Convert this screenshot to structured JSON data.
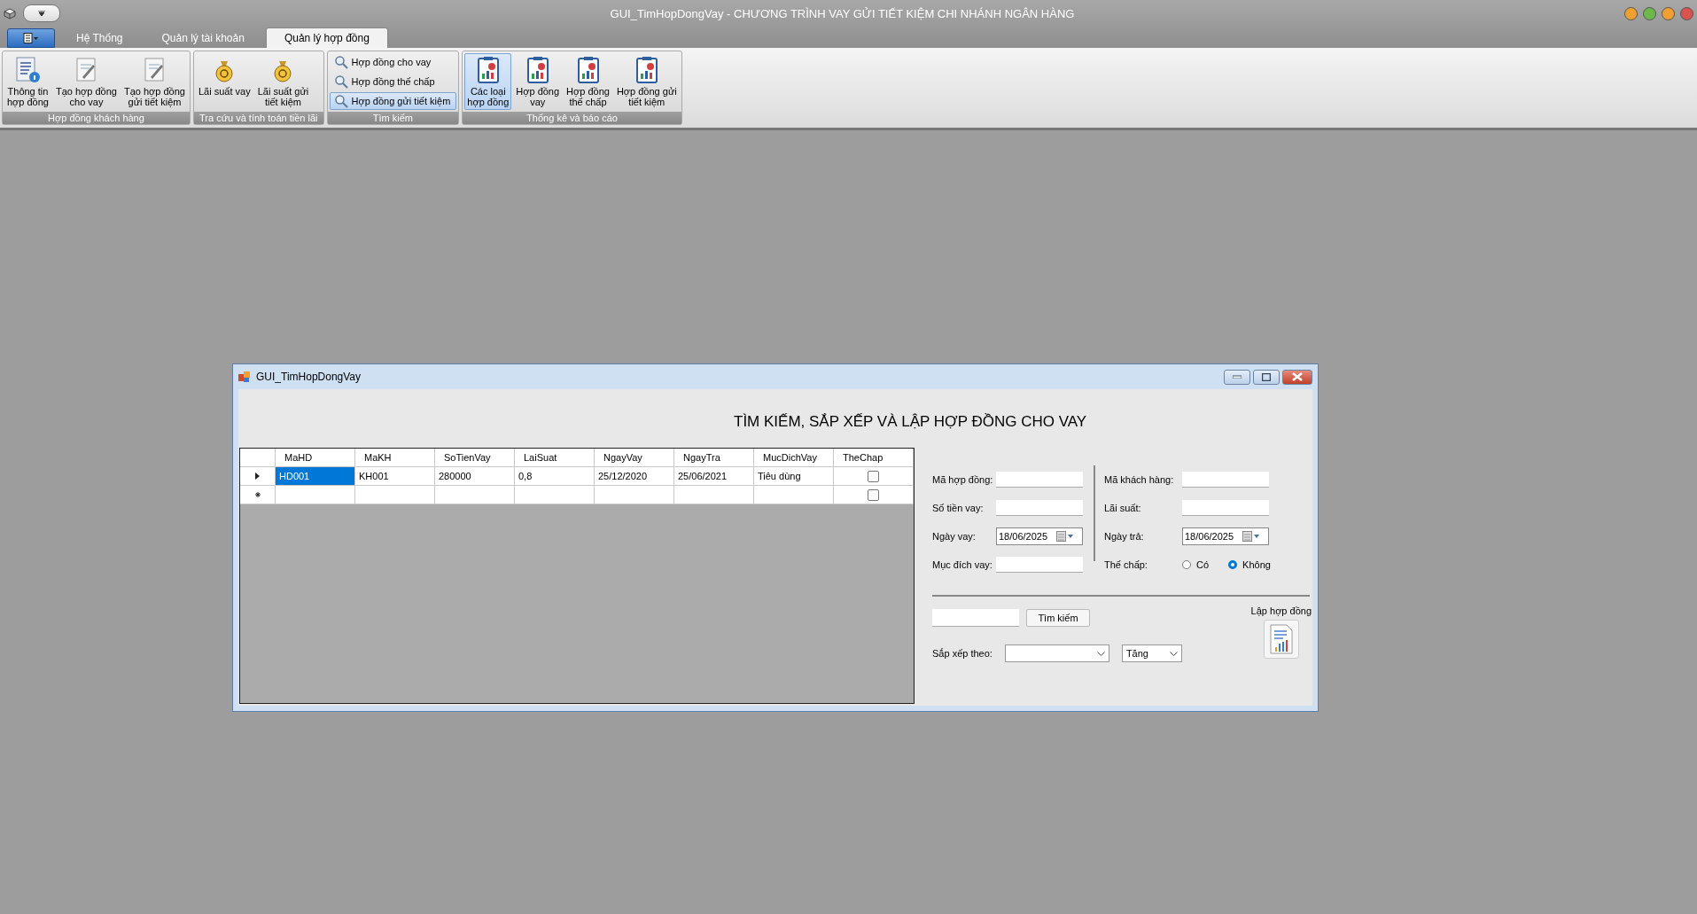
{
  "window": {
    "title": "GUI_TimHopDongVay - CHƯƠNG TRÌNH VAY GỬI TIẾT KIỆM CHI NHÁNH NGÂN HÀNG",
    "orbs": [
      {
        "color": "#f0a030"
      },
      {
        "color": "#6cb84a"
      },
      {
        "color": "#f0a030"
      },
      {
        "color": "#d9534f"
      }
    ]
  },
  "tabs": [
    {
      "label": "Hệ Thống",
      "selected": false
    },
    {
      "label": "Quản lý tài khoản",
      "selected": false
    },
    {
      "label": "Quản lý hợp đồng",
      "selected": true
    }
  ],
  "ribbon_groups": [
    {
      "label": "Hợp đồng khách hàng",
      "items": [
        {
          "kind": "large",
          "label": "Thông tin\nhợp đồng",
          "selected": false
        },
        {
          "kind": "large",
          "label": "Tạo hợp đồng\ncho vay",
          "selected": false
        },
        {
          "kind": "large",
          "label": "Tạo hợp đồng\ngửi tiết kiệm",
          "selected": false
        }
      ]
    },
    {
      "label": "Tra cứu và tính toán tiền lãi",
      "items": [
        {
          "kind": "large",
          "label": "Lãi suất vay",
          "selected": false
        },
        {
          "kind": "large",
          "label": "Lãi suất gửi\ntiết kiệm",
          "selected": false
        }
      ]
    },
    {
      "label": "Tìm kiếm",
      "items": [
        {
          "kind": "small",
          "label": "Hợp đồng cho vay",
          "selected": false
        },
        {
          "kind": "small",
          "label": "Hợp đồng thế chấp",
          "selected": false
        },
        {
          "kind": "small",
          "label": "Hợp đồng gửi tiết kiệm",
          "selected": true
        }
      ]
    },
    {
      "label": "Thống kê và báo cáo",
      "items": [
        {
          "kind": "large",
          "label": "Các loại\nhợp đồng",
          "selected": true
        },
        {
          "kind": "large",
          "label": "Hợp đồng\nvay",
          "selected": false
        },
        {
          "kind": "large",
          "label": "Hợp đồng\nthế chấp",
          "selected": false
        },
        {
          "kind": "large",
          "label": "Hợp đồng gửi\ntiết kiệm",
          "selected": false
        }
      ]
    }
  ],
  "dialog": {
    "title": "GUI_TimHopDongVay",
    "heading": "TÌM KIẾM, SẮP XẾP VÀ LẬP HỢP ĐỒNG CHO VAY",
    "table": {
      "columns": [
        "MaHD",
        "MaKH",
        "SoTienVay",
        "LaiSuat",
        "NgayVay",
        "NgayTra",
        "MucDichVay",
        "TheChap"
      ],
      "rows": [
        {
          "kind": "current",
          "cells": [
            {
              "text": "HD001",
              "selected": true
            },
            {
              "text": "KH001",
              "selected": false
            },
            {
              "text": "280000",
              "selected": false
            },
            {
              "text": "0,8",
              "selected": false
            },
            {
              "text": "25/12/2020",
              "selected": false
            },
            {
              "text": "25/06/2021",
              "selected": false
            },
            {
              "text": "Tiêu dùng",
              "selected": false
            }
          ],
          "thechap": false
        },
        {
          "kind": "new",
          "cells": [],
          "thechap": false
        }
      ]
    },
    "left_fields": [
      {
        "kind": "text",
        "label": "Mã hợp đồng:"
      },
      {
        "kind": "text",
        "label": "Số tiền vay:"
      },
      {
        "kind": "date",
        "label": "Ngày vay:",
        "value": "18/06/2025"
      },
      {
        "kind": "text",
        "label": "Mục đích vay:"
      }
    ],
    "right_fields": [
      {
        "kind": "text",
        "label": "Mã khách hàng:"
      },
      {
        "kind": "text",
        "label": "Lãi suất:"
      },
      {
        "kind": "date",
        "label": "Ngày trả:",
        "value": "18/06/2025"
      },
      {
        "kind": "radio",
        "label": "Thế chấp:",
        "options": [
          {
            "label": "Có",
            "selected": false
          },
          {
            "label": "Không",
            "selected": true
          }
        ]
      }
    ],
    "search_button": "Tìm kiếm",
    "sort": {
      "label": "Sắp xếp theo:",
      "order": "Tăng"
    },
    "create": {
      "label": "Lập hợp đồng"
    }
  }
}
